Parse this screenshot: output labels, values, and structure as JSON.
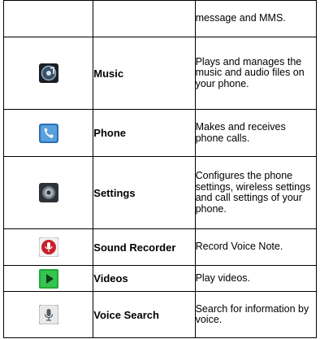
{
  "rows": [
    {
      "icon": "",
      "name": "",
      "description": "message and MMS."
    },
    {
      "icon": "music-icon",
      "name": "Music",
      "description": "Plays and manages the music and audio files on your phone."
    },
    {
      "icon": "phone-icon",
      "name": "Phone",
      "description": "Makes and receives phone calls."
    },
    {
      "icon": "settings-icon",
      "name": "Settings",
      "description": "Configures the phone settings, wireless settings and call settings of your phone."
    },
    {
      "icon": "sound-recorder-icon",
      "name": "Sound Recorder",
      "description": "Record Voice Note."
    },
    {
      "icon": "videos-icon",
      "name": "Videos",
      "description": "Play videos."
    },
    {
      "icon": "voice-search-icon",
      "name": "Voice Search",
      "description": "Search for information by voice."
    }
  ]
}
